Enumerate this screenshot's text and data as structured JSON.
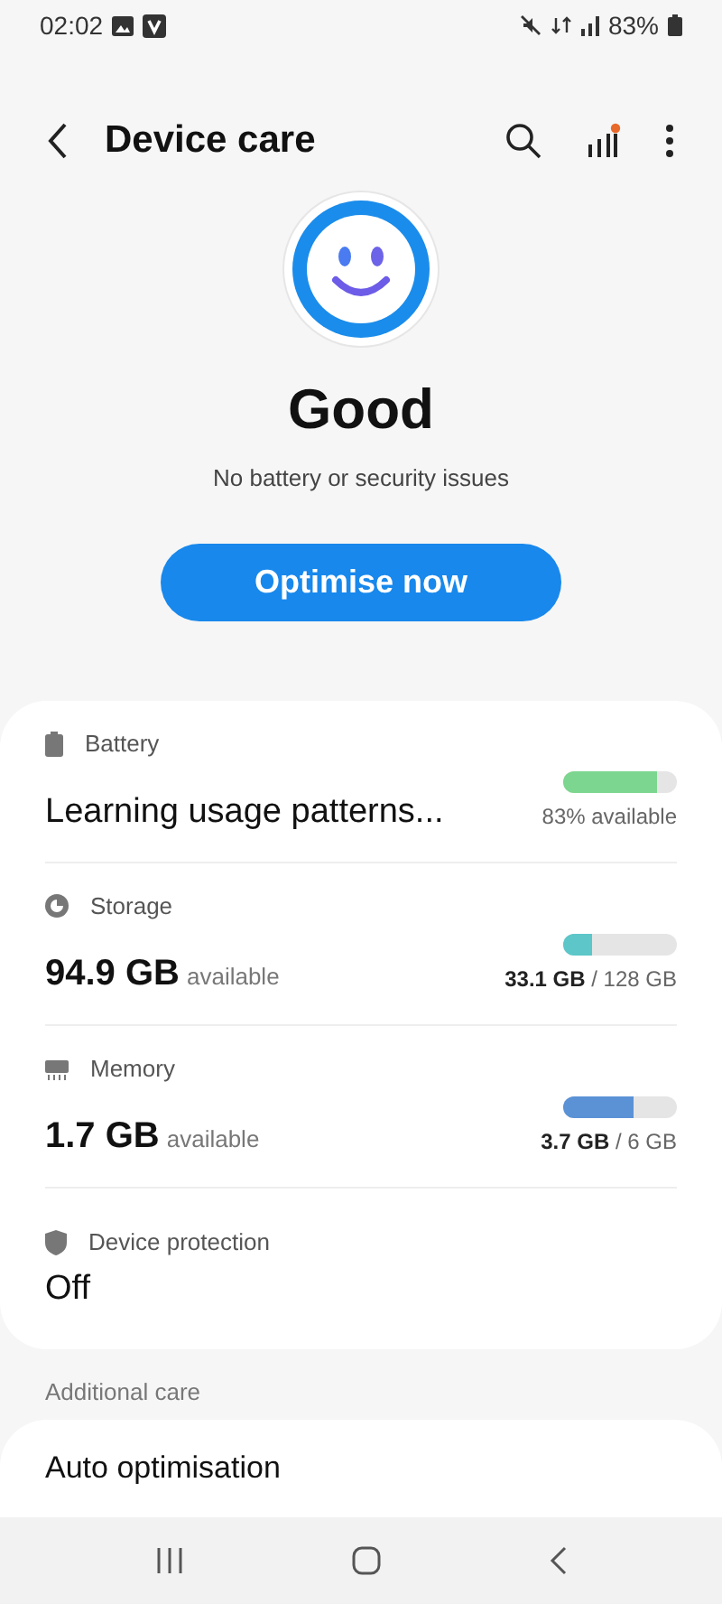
{
  "status_bar": {
    "time": "02:02",
    "battery": "83%"
  },
  "header": {
    "title": "Device care"
  },
  "status": {
    "title": "Good",
    "subtitle": "No battery or security issues"
  },
  "action_button": "Optimise now",
  "items": [
    {
      "kind": "battery",
      "label": "Battery",
      "value": "Learning usage patterns...",
      "level": 0.83,
      "color": "#7dd68f",
      "reading": "83% available"
    },
    {
      "kind": "storage",
      "label": "Storage",
      "value": "94.9 GB",
      "unit": "available",
      "level": 0.26,
      "color": "#5cc6c9",
      "reading": "**33.1 GB** / 128 GB"
    },
    {
      "kind": "memory",
      "label": "Memory",
      "value": "1.7 GB",
      "unit": "available",
      "level": 0.62,
      "color": "#5b92d6",
      "reading": "**3.7 GB** / 6 GB"
    },
    {
      "kind": "protection",
      "label": "Device protection",
      "value": "Off"
    }
  ],
  "additional": {
    "heading": "Additional care",
    "items": [
      "Auto optimisation"
    ]
  }
}
